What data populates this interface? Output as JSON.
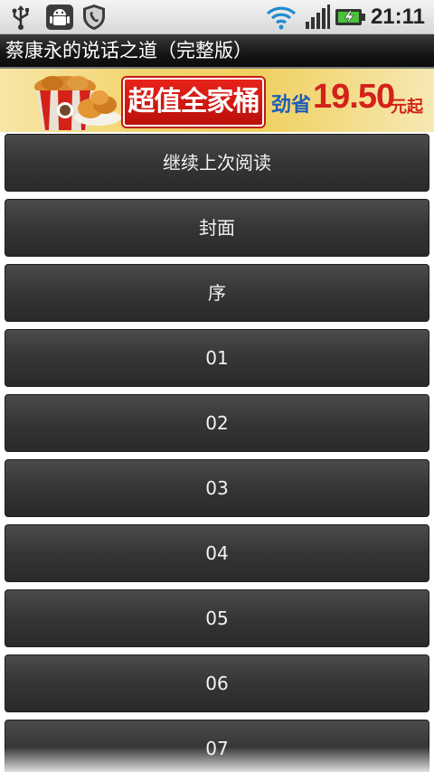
{
  "status_bar": {
    "time": "21:11",
    "icons": [
      "usb-icon",
      "android-debug-icon",
      "shield-icon",
      "wifi-icon",
      "signal-icon",
      "battery-charging-icon"
    ]
  },
  "title_bar": {
    "title": "蔡康永的说话之道（完整版）"
  },
  "ad": {
    "slogan": "超值全家桶",
    "price_label": "劲省",
    "price": "19.50",
    "unit": "元起"
  },
  "menu": {
    "items": [
      "继续上次阅读",
      "封面",
      "序",
      "01",
      "02",
      "03",
      "04",
      "05",
      "06",
      "07"
    ]
  }
}
